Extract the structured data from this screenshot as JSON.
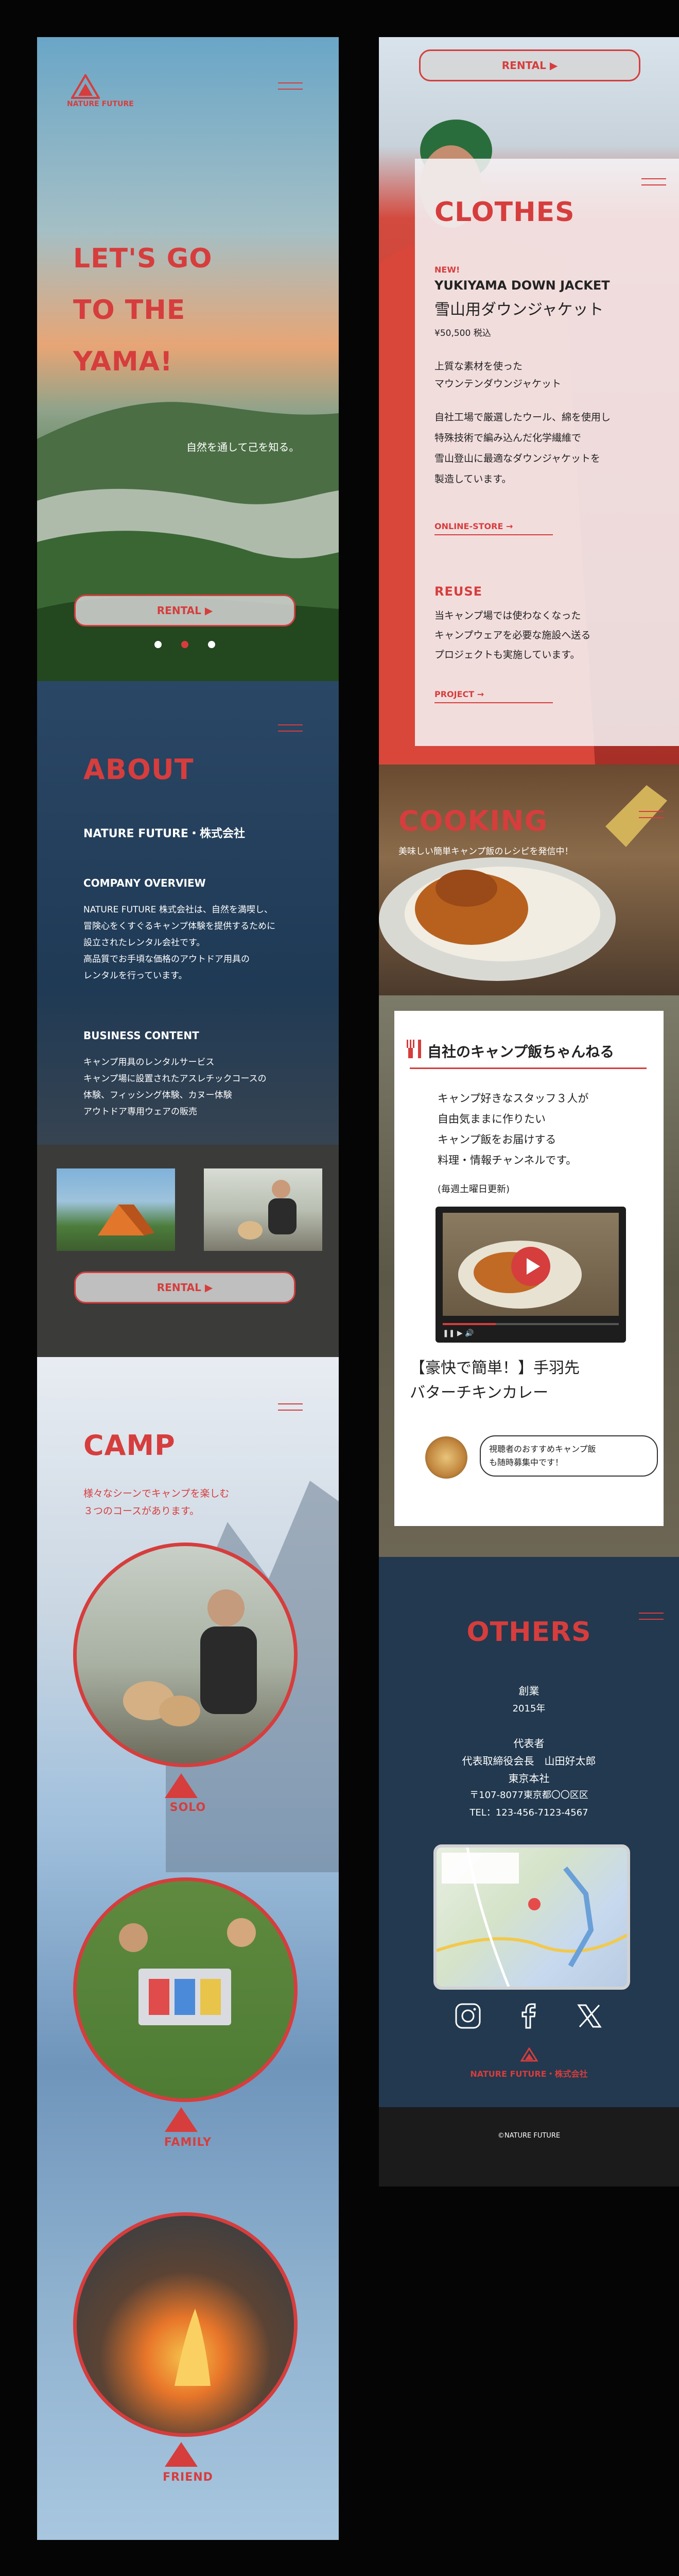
{
  "brand": {
    "name": "NATURE FUTURE",
    "color": "#d63d3d"
  },
  "hero": {
    "headline_lines": [
      "LET'S GO",
      "TO THE",
      "YAMA!"
    ],
    "tagline": "自然を通して己を知る。",
    "rental_label": "RENTAL ▶"
  },
  "about": {
    "heading": "ABOUT",
    "company_name": "NATURE FUTURE・株式会社",
    "overview_title": "COMPANY OVERVIEW",
    "overview_lines": [
      "NATURE FUTURE 株式会社は、自然を満喫し、",
      "冒険心をくすぐるキャンプ体験を提供するために",
      "設立されたレンタル会社です。",
      "高品質でお手頃な価格のアウトドア用具の",
      "レンタルを行っています。"
    ],
    "business_title": "BUSINESS CONTENT",
    "business_lines": [
      "キャンプ用具のレンタルサービス",
      "キャンプ場に設置されたアスレチックコースの",
      "体験、フィッシング体験、カヌー体験",
      "アウトドア専用ウェアの販売"
    ],
    "rental_label": "RENTAL ▶"
  },
  "camp": {
    "heading": "CAMP",
    "intro_lines": [
      "様々なシーンでキャンプを楽しむ",
      "３つのコースがあります。"
    ],
    "courses": [
      {
        "label": "SOLO"
      },
      {
        "label": "FAMILY"
      },
      {
        "label": "FRIEND"
      }
    ]
  },
  "clothes": {
    "top_rental_label": "RENTAL ▶",
    "heading": "CLOTHES",
    "badge": "NEW!",
    "product_name_en": "YUKIYAMA DOWN JACKET",
    "product_name_jp": "雪山用ダウンジャケット",
    "price": "¥50,500 税込",
    "desc_lines_1": [
      "上質な素材を使った",
      "マウンテンダウンジャケット"
    ],
    "desc_lines_2": [
      "自社工場で厳選したウール、綿を使用し",
      "特殊技術で編み込んだ化学繊維で",
      "雪山登山に最適なダウンジャケットを",
      "製造しています。"
    ],
    "store_link": "ONLINE-STORE →",
    "reuse_title": "REUSE",
    "reuse_lines": [
      "当キャンプ場では使わなくなった",
      "キャンプウェアを必要な施設へ送る",
      "プロジェクトも実施しています。"
    ],
    "project_link": "PROJECT →"
  },
  "cooking": {
    "heading": "COOKING",
    "subtitle": "美味しい簡単キャンプ飯のレシピを発信中！",
    "channel_title": "自社のキャンプ飯ちゃんねる",
    "channel_lines": [
      "キャンプ好きなスタッフ３人が",
      "自由気ままに作りたい",
      "キャンプ飯をお届けする",
      "料理・情報チャンネルです。"
    ],
    "update_note": "(毎週土曜日更新)",
    "video_title_lines": [
      "【豪快で簡単！】手羽先",
      "バターチキンカレー"
    ],
    "bubble_lines": [
      "視聴者のおすすめキャンプ飯",
      "も随時募集中です！"
    ]
  },
  "others": {
    "heading": "OTHERS",
    "founded_label": "創業",
    "founded_year": "2015年",
    "rep_label": "代表者",
    "rep_name": "代表取締役会長　山田好太郎",
    "office_label": "東京本社",
    "address": "〒107-8077東京都〇〇区区",
    "tel": "TEL：123-456-7123-4567",
    "footer_brand": "NATURE FUTURE・株式会社",
    "copyright": "©NATURE FUTURE"
  }
}
